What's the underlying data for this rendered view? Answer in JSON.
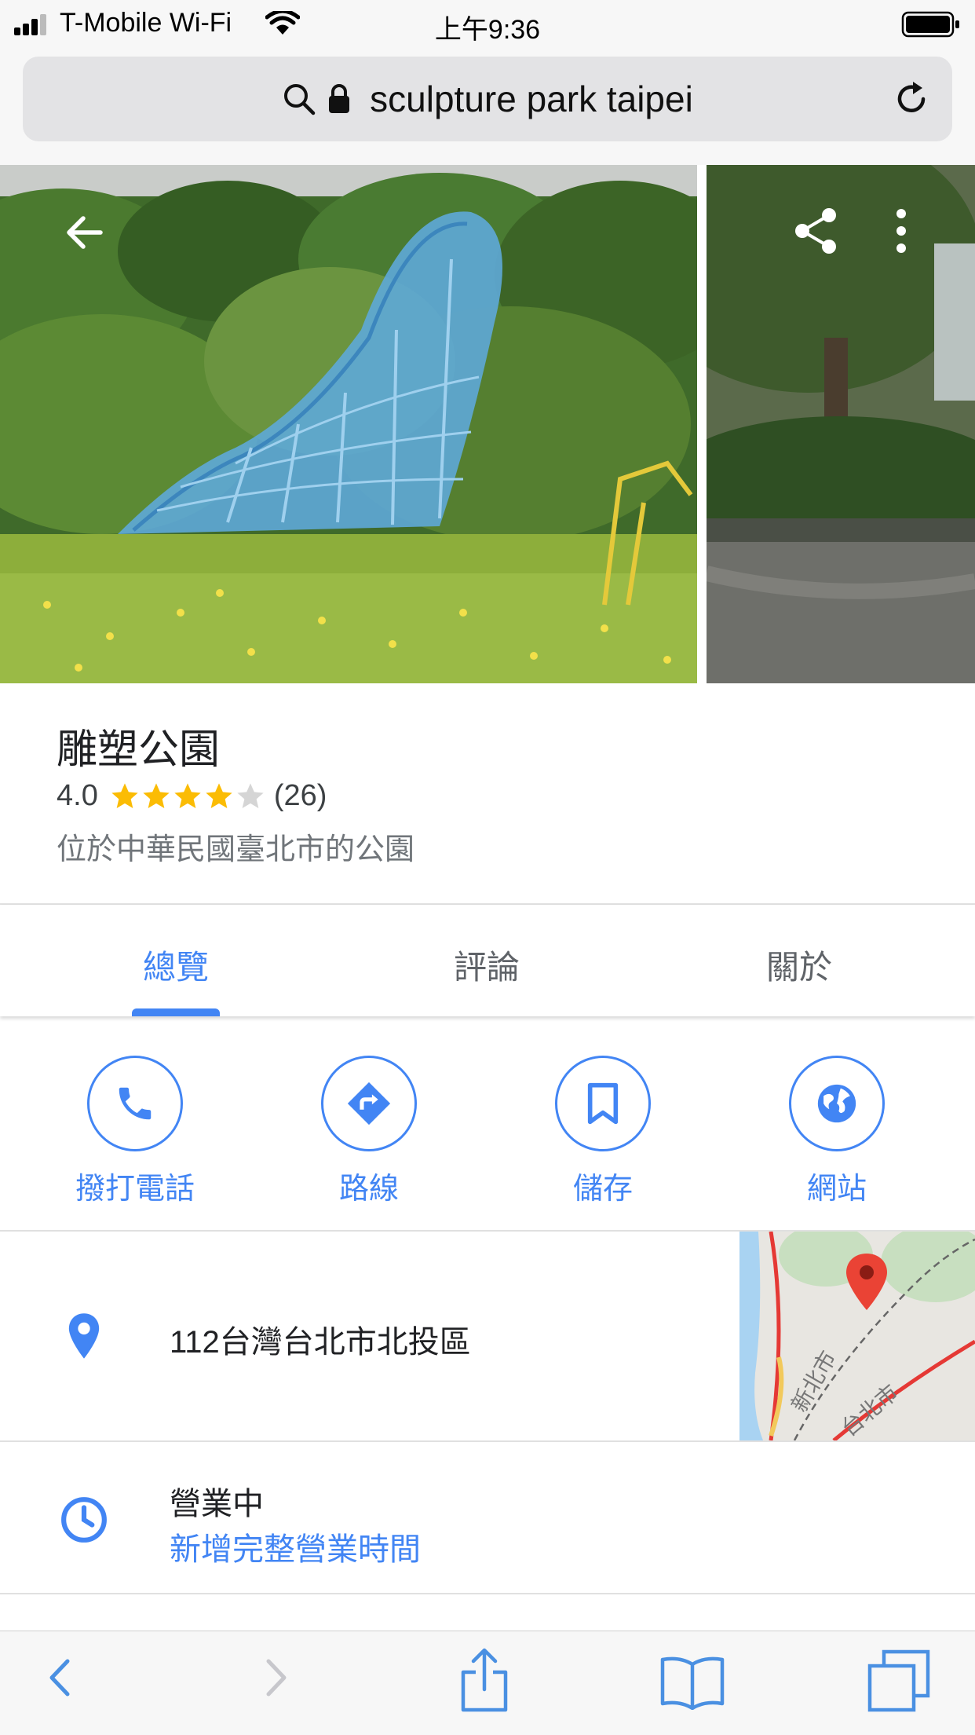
{
  "status": {
    "carrier": "T-Mobile Wi-Fi",
    "time": "上午9:36"
  },
  "browser": {
    "url": "sculpture park taipei"
  },
  "place": {
    "name": "雕塑公園",
    "rating": "4.0",
    "stars": 4,
    "review_count": "(26)",
    "description": "位於中華民國臺北市的公園"
  },
  "tabs": [
    {
      "label": "總覽",
      "active": true
    },
    {
      "label": "評論",
      "active": false
    },
    {
      "label": "關於",
      "active": false
    }
  ],
  "actions": [
    {
      "label": "撥打電話",
      "icon": "phone-icon"
    },
    {
      "label": "路線",
      "icon": "directions-icon"
    },
    {
      "label": "儲存",
      "icon": "bookmark-icon"
    },
    {
      "label": "網站",
      "icon": "globe-icon"
    }
  ],
  "address": {
    "text": "112台灣台北市北投區",
    "map_labels": [
      "新北市",
      "台北市"
    ]
  },
  "hours": {
    "status": "營業中",
    "add_hours": "新增完整營業時間"
  },
  "colors": {
    "accent": "#4285f4",
    "star": "#fbbc04",
    "pin": "#ea4335"
  }
}
